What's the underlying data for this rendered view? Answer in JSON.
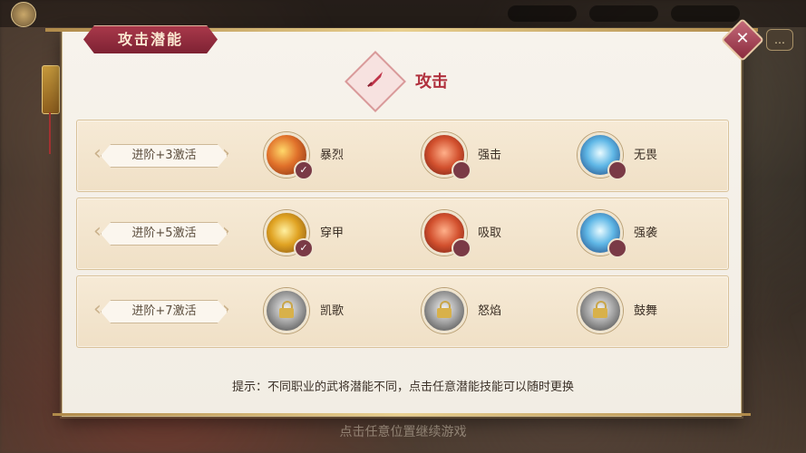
{
  "panel": {
    "title": "攻击潜能",
    "close_icon": "close-icon",
    "category": {
      "title": "攻击",
      "icon": "sword-icon",
      "accent": "#b0303d"
    }
  },
  "rows": [
    {
      "tier": "进阶+3激活",
      "skills": [
        {
          "name": "暴烈",
          "style": "fire",
          "selected": true
        },
        {
          "name": "强击",
          "style": "flame",
          "selected": false
        },
        {
          "name": "无畏",
          "style": "ice",
          "selected": false
        }
      ]
    },
    {
      "tier": "进阶+5激活",
      "skills": [
        {
          "name": "穿甲",
          "style": "gold",
          "selected": true
        },
        {
          "name": "吸取",
          "style": "flame",
          "selected": false
        },
        {
          "name": "强袭",
          "style": "ice",
          "selected": false
        }
      ]
    },
    {
      "tier": "进阶+7激活",
      "skills": [
        {
          "name": "凯歌",
          "style": "locked",
          "locked": true
        },
        {
          "name": "怒焰",
          "style": "locked",
          "locked": true
        },
        {
          "name": "鼓舞",
          "style": "locked",
          "locked": true
        }
      ]
    }
  ],
  "hint": "提示：不同职业的武将潜能不同，点击任意潜能技能可以随时更换",
  "footer_hint": "点击任意位置继续游戏",
  "check_glyph": "✓",
  "close_glyph": "✕",
  "chat_glyph": "…"
}
